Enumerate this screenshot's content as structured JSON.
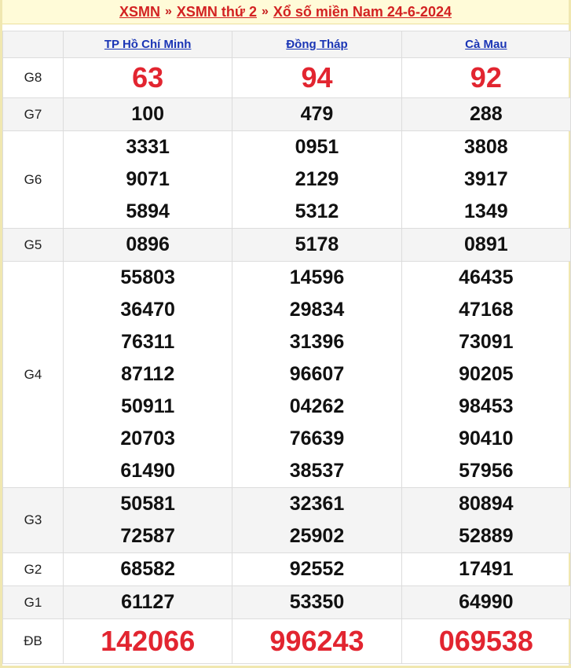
{
  "header": {
    "part1": "XSMN",
    "sep1": "»",
    "part2": "XSMN thứ 2",
    "sep2": "»",
    "part3": "Xổ số miền Nam 24-6-2024"
  },
  "provinces": [
    "TP Hồ Chí Minh",
    "Đồng Tháp",
    "Cà Mau"
  ],
  "prizes": [
    {
      "label": "G8",
      "style": "big",
      "values": [
        [
          "63"
        ],
        [
          "94"
        ],
        [
          "92"
        ]
      ]
    },
    {
      "label": "G7",
      "style": "normal",
      "values": [
        [
          "100"
        ],
        [
          "479"
        ],
        [
          "288"
        ]
      ]
    },
    {
      "label": "G6",
      "style": "normal",
      "values": [
        [
          "3331",
          "9071",
          "5894"
        ],
        [
          "0951",
          "2129",
          "5312"
        ],
        [
          "3808",
          "3917",
          "1349"
        ]
      ]
    },
    {
      "label": "G5",
      "style": "normal",
      "values": [
        [
          "0896"
        ],
        [
          "5178"
        ],
        [
          "0891"
        ]
      ]
    },
    {
      "label": "G4",
      "style": "normal",
      "values": [
        [
          "55803",
          "36470",
          "76311",
          "87112",
          "50911",
          "20703",
          "61490"
        ],
        [
          "14596",
          "29834",
          "31396",
          "96607",
          "04262",
          "76639",
          "38537"
        ],
        [
          "46435",
          "47168",
          "73091",
          "90205",
          "98453",
          "90410",
          "57956"
        ]
      ]
    },
    {
      "label": "G3",
      "style": "normal",
      "values": [
        [
          "50581",
          "72587"
        ],
        [
          "32361",
          "25902"
        ],
        [
          "80894",
          "52889"
        ]
      ]
    },
    {
      "label": "G2",
      "style": "normal",
      "values": [
        [
          "68582"
        ],
        [
          "92552"
        ],
        [
          "17491"
        ]
      ]
    },
    {
      "label": "G1",
      "style": "normal",
      "values": [
        [
          "61127"
        ],
        [
          "53350"
        ],
        [
          "64990"
        ]
      ]
    },
    {
      "label": "ĐB",
      "style": "db",
      "values": [
        [
          "142066"
        ],
        [
          "996243"
        ],
        [
          "069538"
        ]
      ]
    }
  ]
}
